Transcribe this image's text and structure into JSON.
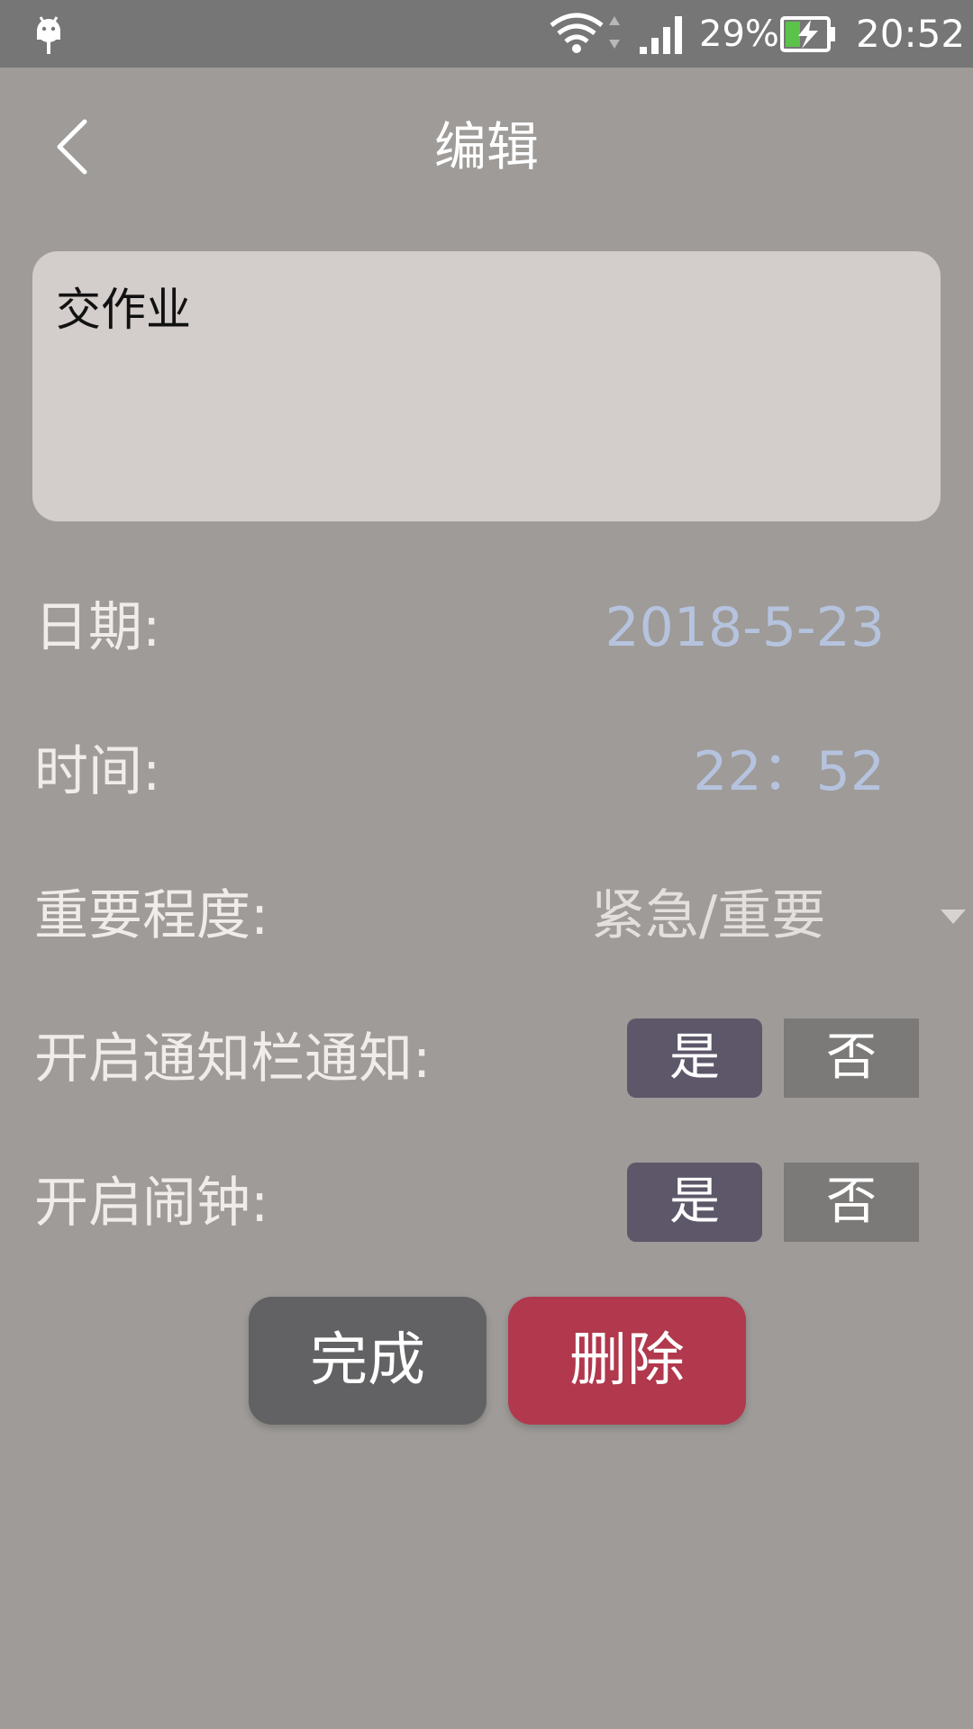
{
  "status_bar": {
    "battery_percent": "29%",
    "time": "20:52",
    "icons": [
      "android-debug-icon",
      "wifi-icon",
      "signal-icon",
      "battery-charging-icon"
    ]
  },
  "header": {
    "title": "编辑"
  },
  "memo": {
    "text": "交作业"
  },
  "form": {
    "date_label": "日期:",
    "date_value": "2018-5-23",
    "time_label": "时间:",
    "time_value": "22：52",
    "priority_label": "重要程度:",
    "priority_value": "紧急/重要",
    "notify_label": "开启通知栏通知:",
    "alarm_label": "开启闹钟:",
    "yes_label": "是",
    "no_label": "否"
  },
  "actions": {
    "done_label": "完成",
    "delete_label": "删除"
  },
  "colors": {
    "background": "#9e9b98",
    "status_bar": "#767676",
    "value_text": "#b6c3de",
    "yes_selected": "#5d5769",
    "no_unselected": "#7b7a78",
    "done_button": "#626264",
    "delete_button": "#b1384d"
  }
}
